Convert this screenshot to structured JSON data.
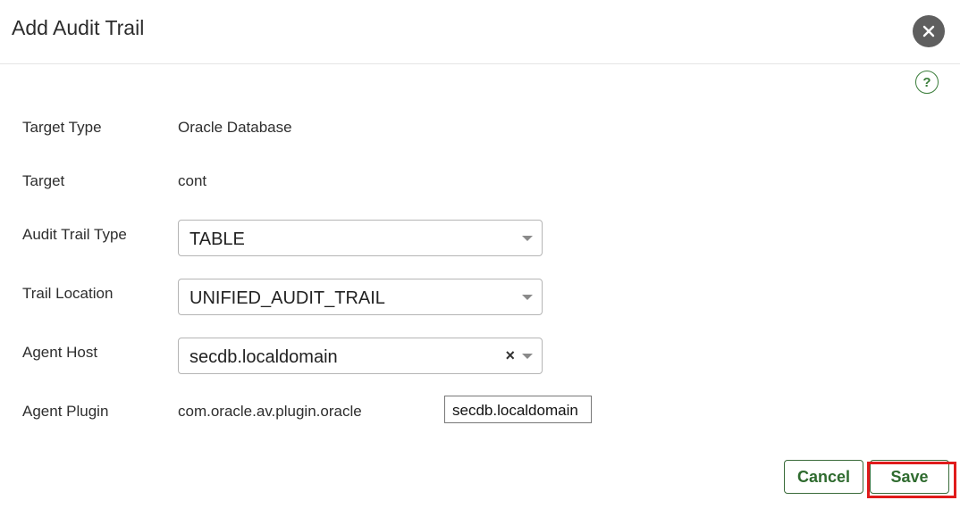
{
  "dialog": {
    "title": "Add Audit Trail",
    "close_icon": "close-icon",
    "help_icon": "help-icon",
    "help_glyph": "?"
  },
  "form": {
    "target_type": {
      "label": "Target Type",
      "value": "Oracle Database"
    },
    "target": {
      "label": "Target",
      "value": "cont"
    },
    "audit_trail_type": {
      "label": "Audit Trail Type",
      "value": "TABLE"
    },
    "trail_location": {
      "label": "Trail Location",
      "value": "UNIFIED_AUDIT_TRAIL"
    },
    "agent_host": {
      "label": "Agent Host",
      "value": "secdb.localdomain",
      "clear_glyph": "×"
    },
    "agent_plugin": {
      "label": "Agent Plugin",
      "value": "com.oracle.av.plugin.oracle"
    }
  },
  "tooltip": {
    "text": "secdb.localdomain"
  },
  "footer": {
    "cancel_label": "Cancel",
    "save_label": "Save"
  },
  "colors": {
    "accent_green": "#2f6b2f",
    "highlight_red": "#e01b1b",
    "close_bg": "#5f5f5f"
  }
}
